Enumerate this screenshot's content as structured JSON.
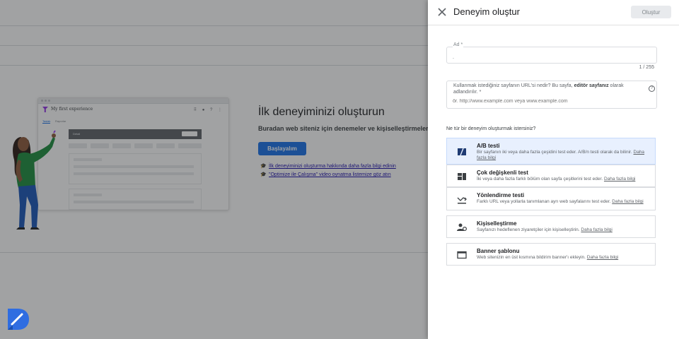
{
  "background": {
    "heading": "İlk deneyiminizi oluşturun",
    "subheading": "Buradan web siteniz için denemeler ve kişiselleştirmeler",
    "start_button": "Başlayalım",
    "link1": "İlk deneyiminizi oluşturma hakkında daha fazla bilgi edinin",
    "link2": "\"Optimize ile Çalışma\" video oynatma listemize göz atın",
    "illustration": {
      "title": "My first experience",
      "tab_active": "Taslak",
      "tab_other": "Raporlar",
      "bar_label": "Detail"
    }
  },
  "drawer": {
    "title": "Deneyim oluştur",
    "create_button": "Oluştur",
    "name_field": {
      "label": "Ad *",
      "value": ".",
      "counter": "1 / 255"
    },
    "url_field": {
      "label_part1": "Kullanmak istediğiniz sayfanın URL'si nedir? Bu sayfa, ",
      "label_bold": "editör sayfanız",
      "label_part2": " olarak adlandırılır. *",
      "placeholder": "ör. http://www.example.com veya www.example.com"
    },
    "question": "Ne tür bir deneyim oluşturmak istersiniz?",
    "options": [
      {
        "title": "A/B testi",
        "desc": "Bir sayfanın iki veya daha fazla çeşidini test eder. A/B/n testi olarak da bilinir.",
        "link": "Daha fazla bilgi",
        "icon": "ab-test-icon",
        "selected": true
      },
      {
        "title": "Çok değişkenli test",
        "desc": "İki veya daha fazla farklı bölüm olan sayfa çeşitlerini test eder.",
        "link": "Daha fazla bilgi",
        "icon": "multivariate-icon",
        "selected": false
      },
      {
        "title": "Yönlendirme testi",
        "desc": "Farklı URL veya yollarla tanımlanan ayrı web sayfalarını test eder.",
        "link": "Daha fazla bilgi",
        "icon": "redirect-icon",
        "selected": false
      },
      {
        "title": "Kişiselleştirme",
        "desc": "Sayfanızı hedeflenen ziyaretçiler için kişiselleştirin.",
        "link": "Daha fazla bilgi",
        "icon": "personalization-icon",
        "selected": false
      },
      {
        "title": "Banner şablonu",
        "desc": "Web sitenizin en üst kısmına bildirim banner'ı ekleyin.",
        "link": "Daha fazla bilgi",
        "icon": "banner-icon",
        "selected": false
      }
    ]
  },
  "colors": {
    "accent": "#1a73e8",
    "selected_bg": "#e8f0fe",
    "brand": "#2f6de1"
  }
}
